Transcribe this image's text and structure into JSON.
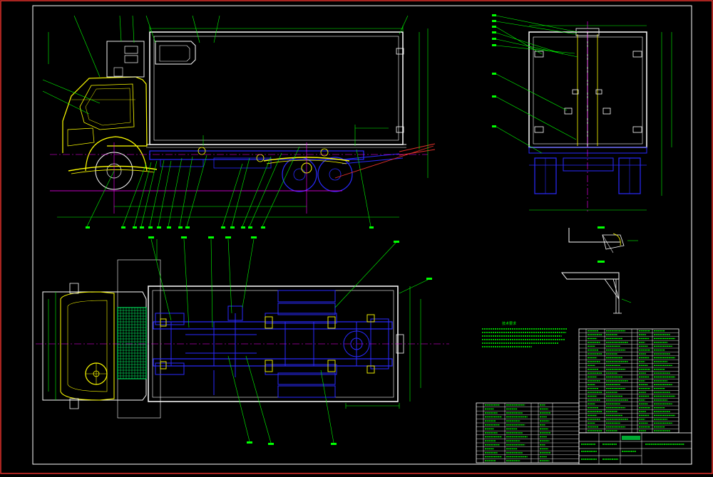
{
  "drawing": {
    "colors": {
      "background": "#000000",
      "outer_frame": "#e0302a",
      "inner_frame": "#ffffff",
      "body_lines": "#ffffff",
      "cab_lines": "#ffff00",
      "chassis_lines": "#2a2aff",
      "leader_lines": "#00ff00",
      "dimension_lines": "#00ff00",
      "center_lines": "#ff00ff",
      "radiator_hatch": "#00ff66",
      "table_lines": "#ffffff",
      "table_text": "#00ff00"
    },
    "views": [
      "side-elevation",
      "rear-elevation",
      "top-plan",
      "section-a",
      "section-b"
    ],
    "notes": {
      "label": "技术要求",
      "lines": [
        "",
        "",
        "",
        "",
        "",
        ""
      ]
    },
    "title_block": {
      "label": ""
    }
  }
}
